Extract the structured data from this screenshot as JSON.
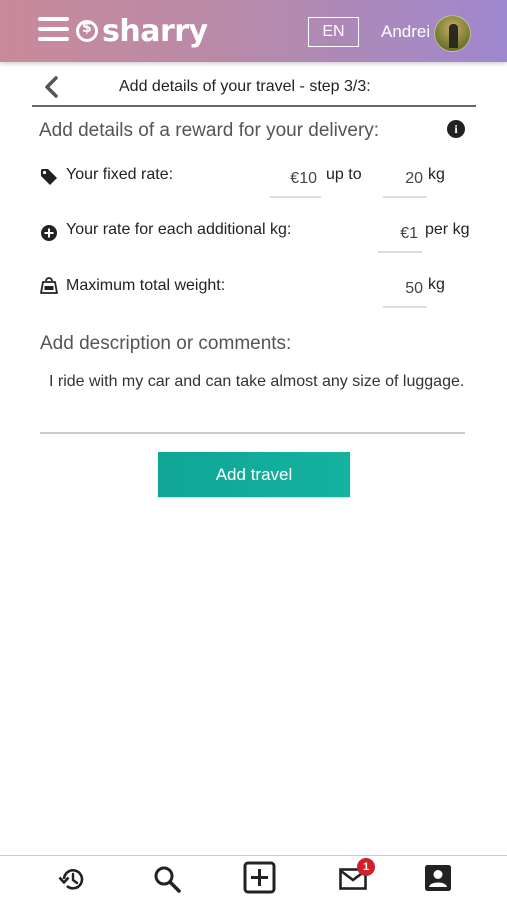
{
  "header": {
    "logo_text": "sharry",
    "language": "EN",
    "user_name": "Andrei",
    "gradient_colors": [
      "#c98a9a",
      "#9f88cf"
    ]
  },
  "step": {
    "title": "Add details of your travel - step 3/3:"
  },
  "reward": {
    "section_title": "Add details of a reward for your delivery:",
    "fixed_rate": {
      "label": "Your fixed rate:",
      "value": "€10",
      "connector": "up to",
      "weight_value": "20",
      "unit": "kg"
    },
    "additional_rate": {
      "label": "Your rate for each additional kg:",
      "value": "€1",
      "unit": "per kg"
    },
    "max_weight": {
      "label": "Maximum total weight:",
      "value": "50",
      "unit": "kg"
    }
  },
  "description": {
    "title": "Add description or comments:",
    "text": "I ride with my car and can take almost any size of luggage."
  },
  "actions": {
    "add_travel": "Add travel",
    "button_color": "#13ad9c"
  },
  "bottom_nav": {
    "items": [
      {
        "icon": "history-icon"
      },
      {
        "icon": "search-icon"
      },
      {
        "icon": "add-box-icon"
      },
      {
        "icon": "mail-icon",
        "badge": "1"
      },
      {
        "icon": "account-box-icon"
      }
    ]
  }
}
